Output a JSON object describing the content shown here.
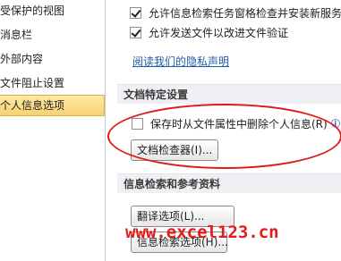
{
  "nav": {
    "items": [
      {
        "label": "受保护的视图",
        "selected": false
      },
      {
        "label": "消息栏",
        "selected": false
      },
      {
        "label": "外部内容",
        "selected": false
      },
      {
        "label": "文件阻止设置",
        "selected": false
      },
      {
        "label": "个人信息选项",
        "selected": true
      }
    ]
  },
  "research_options": {
    "allow_download_label": "允许信息检索任务窗格检查并安装新服务",
    "allow_download_checked": true,
    "allow_send_label": "允许发送文件以改进文件验证",
    "allow_send_checked": true,
    "privacy_link": "阅读我们的隐私声明"
  },
  "document_specific": {
    "section_title": "文档特定设置",
    "remove_info_label": "保存时从文件属性中删除个人信息(R)",
    "remove_info_checked": false,
    "info_icon": "info-icon",
    "inspector_button": "文档检查器(I)..."
  },
  "research": {
    "section_title": "信息检索和参考资料",
    "translation_button": "翻译选项(L)...",
    "research_button": "信息检索选项(H)..."
  },
  "annotation": {
    "ellipse_color": "#e01818"
  },
  "watermark": {
    "text": "www.excel123.cn",
    "color": "#e31b1b"
  }
}
